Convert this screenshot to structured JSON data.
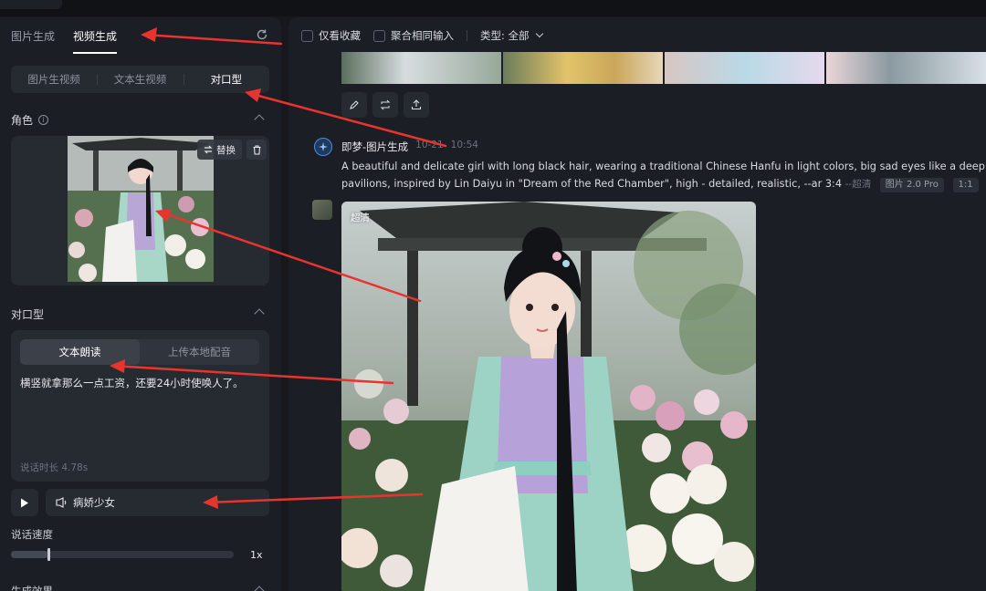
{
  "left_panel": {
    "tabs": [
      {
        "label": "图片生成",
        "active": false
      },
      {
        "label": "视频生成",
        "active": true
      }
    ],
    "subtabs": [
      {
        "label": "图片生视频",
        "active": false
      },
      {
        "label": "文本生视频",
        "active": false
      },
      {
        "label": "对口型",
        "active": true
      }
    ],
    "role": {
      "label": "角色",
      "replace_label": "替换"
    },
    "lip_sync": {
      "label": "对口型",
      "tabs": [
        {
          "label": "文本朗读",
          "active": true
        },
        {
          "label": "上传本地配音",
          "active": false
        }
      ],
      "text": "横竖就拿那么一点工资，还要24小时使唤人了。",
      "duration": "说话时长 4.78s"
    },
    "voice": {
      "name": "病娇少女"
    },
    "speed": {
      "label": "说话速度",
      "value": "1x",
      "level": 0.17
    },
    "generate_effect_label": "生成效果"
  },
  "right_panel": {
    "filters": {
      "favorites_only": "仅看收藏",
      "aggregate_same": "聚合相同输入",
      "type_filter": "类型: 全部"
    },
    "message": {
      "sender": "即梦-图片生成",
      "date": "10-21",
      "time": "10:54",
      "prompt_line1": "A beautiful and delicate girl with long black hair, wearing a traditional Chinese Hanfu in light colors, big sad eyes like a deep pool, fa",
      "prompt_line2": "pavilions, inspired by Lin Daiyu in \"Dream of the Red Chamber\", high - detailed, realistic, --ar 3:4",
      "prompt_suffix": "--超清",
      "model_tag": "图片 2.0 Pro",
      "ratio_tag": "1:1"
    },
    "image_badge": "超清"
  },
  "colors": {
    "background": "#16181d",
    "panel": "#1b1e24",
    "card": "#262a31",
    "annotation_arrow": "#e8342f"
  }
}
